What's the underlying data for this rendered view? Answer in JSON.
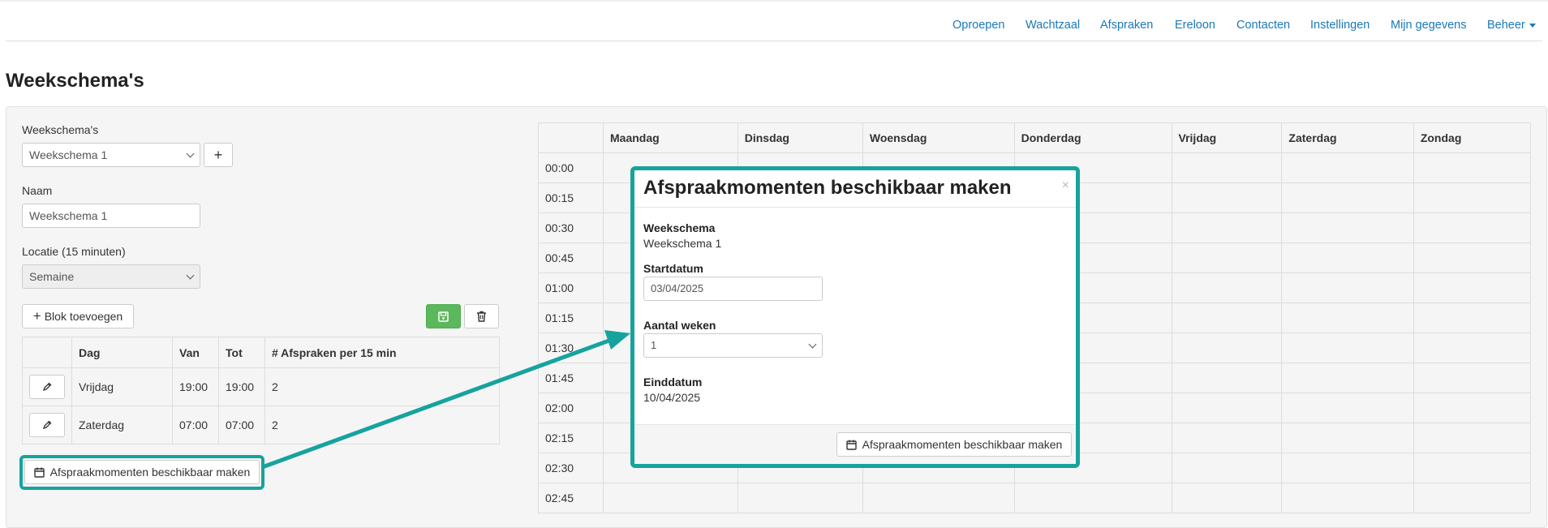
{
  "nav": {
    "items": [
      "Oproepen",
      "Wachtzaal",
      "Afspraken",
      "Ereloon",
      "Contacten",
      "Instellingen",
      "Mijn gegevens",
      "Beheer"
    ]
  },
  "page": {
    "title": "Weekschema's"
  },
  "form": {
    "schedules_label": "Weekschema's",
    "schedule_selected": "Weekschema 1",
    "add_schedule_symbol": "+",
    "name_label": "Naam",
    "name_value": "Weekschema 1",
    "location_label": "Locatie (15 minuten)",
    "location_selected": "Semaine",
    "add_block_label": "Blok toevoegen",
    "make_available_label": "Afspraakmomenten beschikbaar maken"
  },
  "blocks_table": {
    "headers": [
      "",
      "Dag",
      "Van",
      "Tot",
      "# Afspraken per 15 min"
    ],
    "rows": [
      {
        "dag": "Vrijdag",
        "van": "19:00",
        "tot": "19:00",
        "afspraken": "2"
      },
      {
        "dag": "Zaterdag",
        "van": "07:00",
        "tot": "07:00",
        "afspraken": "2"
      }
    ]
  },
  "calendar": {
    "days": [
      "",
      "Maandag",
      "Dinsdag",
      "Woensdag",
      "Donderdag",
      "Vrijdag",
      "Zaterdag",
      "Zondag"
    ],
    "times": [
      "00:00",
      "00:15",
      "00:30",
      "00:45",
      "01:00",
      "01:15",
      "01:30",
      "01:45",
      "02:00",
      "02:15",
      "02:30",
      "02:45"
    ]
  },
  "modal": {
    "title": "Afspraakmomenten beschikbaar maken",
    "close_symbol": "×",
    "schedule_label": "Weekschema",
    "schedule_value": "Weekschema 1",
    "start_label": "Startdatum",
    "start_value": "03/04/2025",
    "weeks_label": "Aantal weken",
    "weeks_value": "1",
    "end_label": "Einddatum",
    "end_value": "10/04/2025",
    "submit_label": "Afspraakmomenten beschikbaar maken"
  },
  "colors": {
    "link": "#1a78b9",
    "highlight": "#16a39e",
    "success": "#5cb85c",
    "panel_bg": "#f5f5f5"
  },
  "icons": {
    "add_block": "plus-icon",
    "save": "save-icon",
    "delete": "trash-icon",
    "edit": "pencil-icon",
    "calendar": "calendar-icon",
    "dropdown": "chevron-down-icon",
    "callout": "arrow-icon"
  }
}
